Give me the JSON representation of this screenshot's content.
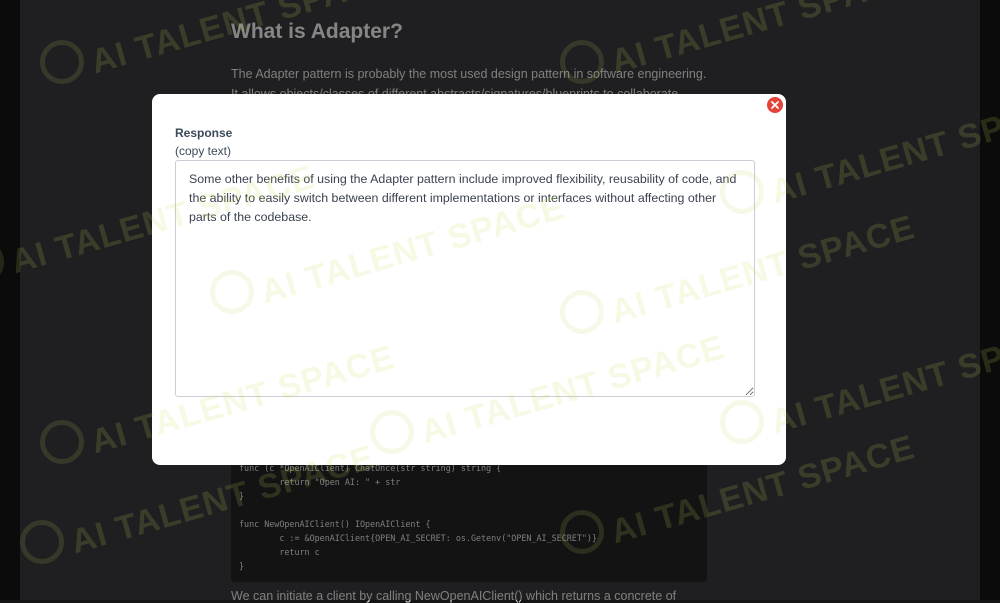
{
  "article": {
    "title": "What is Adapter?",
    "intro": "The Adapter pattern is probably the most used design pattern in software engineering. It allows objects/classes of different abstracts/signatures/blueprints to collaborate.",
    "code_lines": [
      "func (c *OpenAIClient) ChatOnce(str string) string {",
      "        return \"Open AI: \" + str",
      "}",
      "",
      "func NewOpenAIClient() IOpenAIClient {",
      "        c := &OpenAIClient{OPEN_AI_SECRET: os.Getenv(\"OPEN_AI_SECRET\")}",
      "        return c",
      "}"
    ],
    "outro": "We can initiate a client by calling NewOpenAIClient() which returns a concrete of"
  },
  "modal": {
    "close_icon": "close-icon",
    "label": "Response",
    "hint": "(copy text)",
    "response_text": "Some other benefits of using the Adapter pattern include improved flexibility, reusability of code, and the ability to easily switch between different implementations or interfaces without affecting other parts of the codebase."
  },
  "watermark": {
    "text": "AI TALENT SPACE",
    "logo_icon": "ai-talent-space-logo-icon"
  },
  "colors": {
    "page_background": "#3a3a3d",
    "code_background": "#232326",
    "modal_background": "#ffffff",
    "close_button": "#e5423a",
    "label_text": "#3c4a5a",
    "watermark": "#c4d75a"
  }
}
